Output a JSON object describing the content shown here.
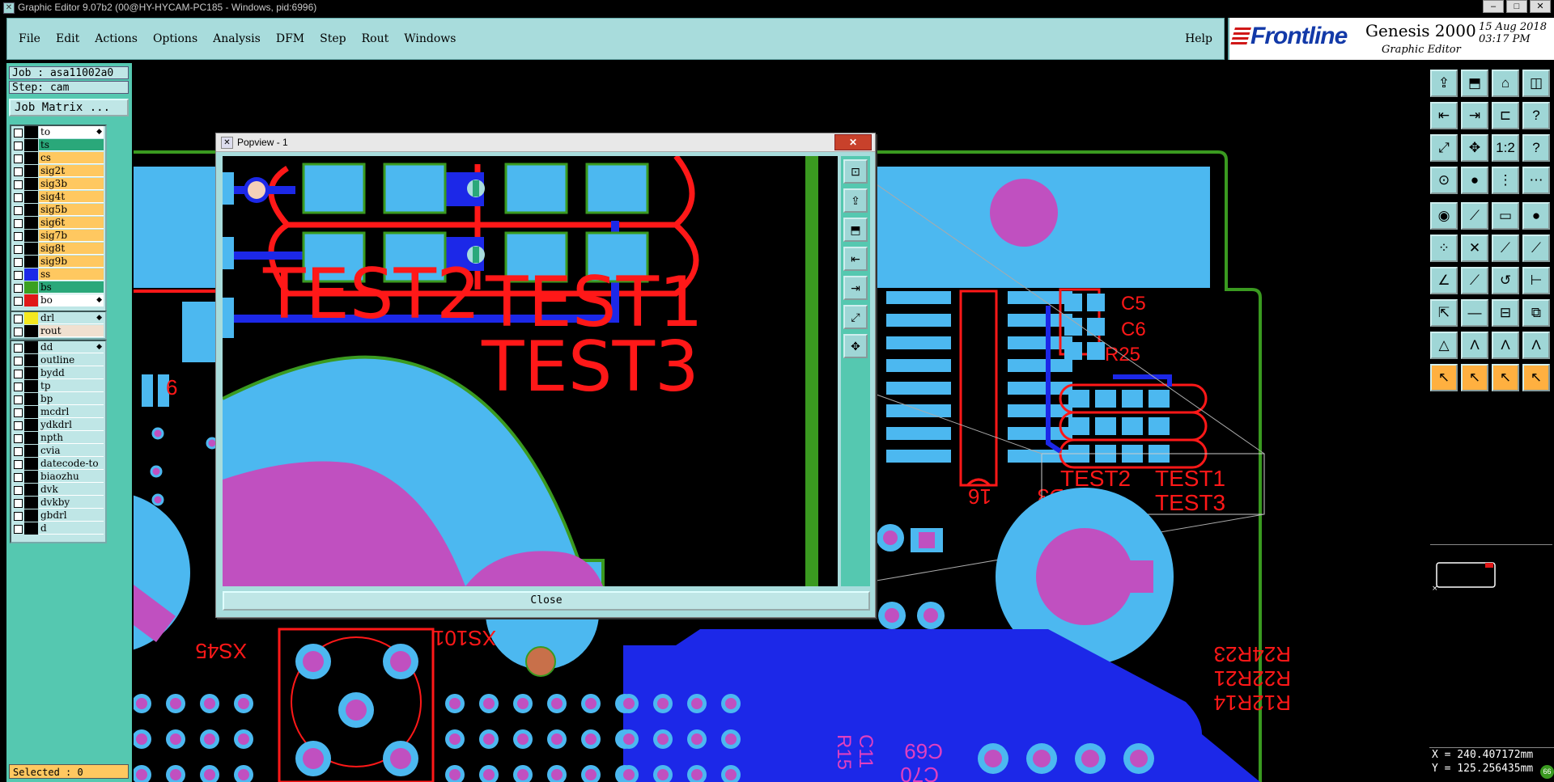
{
  "window": {
    "title": "Graphic Editor 9.07b2 (00@HY-HYCAM-PC185 - Windows, pid:6996)",
    "controls": [
      "–",
      "□",
      "✕"
    ]
  },
  "menu": {
    "items": [
      "File",
      "Edit",
      "Actions",
      "Options",
      "Analysis",
      "DFM",
      "Step",
      "Rout",
      "Windows"
    ],
    "help": "Help"
  },
  "logo": {
    "brand": "Frontline",
    "product": "Genesis 2000",
    "subtitle": "Graphic Editor",
    "date": "15 Aug 2018",
    "time": "03:17 PM"
  },
  "job": {
    "job_label": "Job : asa11002a0",
    "step_label": "Step: cam",
    "matrix_button": "Job Matrix ..."
  },
  "layers_group1": [
    {
      "name": "to",
      "color": "#ffffff",
      "swatch": "#000000",
      "arrow": true
    },
    {
      "name": "ts",
      "color": "#2aa87a",
      "swatch": "#000000"
    },
    {
      "name": "cs",
      "color": "#ffc860",
      "swatch": "#000000"
    },
    {
      "name": "sig2t",
      "color": "#ffc860",
      "swatch": "#000000"
    },
    {
      "name": "sig3b",
      "color": "#ffc860",
      "swatch": "#000000"
    },
    {
      "name": "sig4t",
      "color": "#ffc860",
      "swatch": "#000000"
    },
    {
      "name": "sig5b",
      "color": "#ffc860",
      "swatch": "#000000"
    },
    {
      "name": "sig6t",
      "color": "#ffc860",
      "swatch": "#000000"
    },
    {
      "name": "sig7b",
      "color": "#ffc860",
      "swatch": "#000000"
    },
    {
      "name": "sig8t",
      "color": "#ffc860",
      "swatch": "#000000"
    },
    {
      "name": "sig9b",
      "color": "#ffc860",
      "swatch": "#000000"
    },
    {
      "name": "ss",
      "color": "#ffc860",
      "swatch": "#1c28e8"
    },
    {
      "name": "bs",
      "color": "#2aa87a",
      "swatch": "#3aa020"
    },
    {
      "name": "bo",
      "color": "#ffffff",
      "swatch": "#e01818",
      "arrow": true
    }
  ],
  "layers_group2": [
    {
      "name": "drl",
      "color": "#bfe6e6",
      "swatch": "#f4e820",
      "arrow": true
    },
    {
      "name": "rout",
      "color": "#f0e0d0",
      "swatch": "#000000"
    }
  ],
  "layers_group3": [
    {
      "name": "dd",
      "color": "#bfe6e6",
      "swatch": "#000000",
      "arrow": true
    },
    {
      "name": "outline",
      "color": "#bfe6e6",
      "swatch": "#000000"
    },
    {
      "name": "bydd",
      "color": "#bfe6e6",
      "swatch": "#000000"
    },
    {
      "name": "tp",
      "color": "#bfe6e6",
      "swatch": "#000000"
    },
    {
      "name": "bp",
      "color": "#bfe6e6",
      "swatch": "#000000"
    },
    {
      "name": "mcdrl",
      "color": "#bfe6e6",
      "swatch": "#000000"
    },
    {
      "name": "ydkdrl",
      "color": "#bfe6e6",
      "swatch": "#000000"
    },
    {
      "name": "npth",
      "color": "#bfe6e6",
      "swatch": "#000000"
    },
    {
      "name": "cvia",
      "color": "#bfe6e6",
      "swatch": "#000000"
    },
    {
      "name": "datecode-to",
      "color": "#bfe6e6",
      "swatch": "#000000"
    },
    {
      "name": "biaozhu",
      "color": "#bfe6e6",
      "swatch": "#000000"
    },
    {
      "name": "dvk",
      "color": "#bfe6e6",
      "swatch": "#000000"
    },
    {
      "name": "dvkby",
      "color": "#bfe6e6",
      "swatch": "#000000"
    },
    {
      "name": "gbdrl",
      "color": "#bfe6e6",
      "swatch": "#000000"
    },
    {
      "name": "d",
      "color": "#bfe6e6",
      "swatch": "#000000"
    }
  ],
  "status": {
    "selected": "Selected : 0",
    "x": "X = 240.407172mm",
    "y": "Y = 125.256435mm"
  },
  "toolbar_icons": [
    [
      "open-icon",
      "save-icon",
      "home-icon",
      "layout-icon"
    ],
    [
      "zoom-in-icon",
      "zoom-out-icon",
      "zoom-fit-icon",
      "help-icon"
    ],
    [
      "fit-all-icon",
      "pan-icon",
      "scale-1-2-icon",
      "question-icon"
    ],
    [
      "snap-icon",
      "measure-icon",
      "net-icon",
      "grid-icon"
    ],
    [
      "pad-icon",
      "line-icon",
      "ruler-icon",
      "circle-icon"
    ],
    [
      "node-icon",
      "cross-icon",
      "point-icon",
      "via-icon"
    ],
    [
      "angle-icon",
      "diagonal-icon",
      "arc-icon",
      "text-icon"
    ],
    [
      "move-icon",
      "edit-line-icon",
      "resize-icon",
      "copy-icon"
    ],
    [
      "triangle-icon",
      "poly-icon",
      "outline-icon",
      "shape-icon"
    ],
    [
      "select-icon",
      "select-area-icon",
      "select-net-icon",
      "select-all-icon"
    ]
  ],
  "toolbar_glyphs": [
    [
      "⇪",
      "⬒",
      "⌂",
      "◫"
    ],
    [
      "⇤",
      "⇥",
      "⊏",
      "?"
    ],
    [
      "⤢",
      "✥",
      "1:2",
      "?"
    ],
    [
      "⊙",
      "●",
      "⋮",
      "⋯"
    ],
    [
      "◉",
      "⟋",
      "▭",
      "●"
    ],
    [
      "⁘",
      "✕",
      "⟋",
      "⟋"
    ],
    [
      "∠",
      "⟋",
      "↺",
      "⊢"
    ],
    [
      "⇱",
      "—",
      "⊟",
      "⧉"
    ],
    [
      "△",
      "Λ",
      "Λ",
      "Λ"
    ],
    [
      "↖",
      "↖",
      "↖",
      "↖"
    ]
  ],
  "popview": {
    "title": "Popview - 1",
    "close_x": "✕",
    "close_button": "Close",
    "texts": [
      "TEST2",
      "TEST1",
      "TEST3"
    ],
    "tool_glyphs": [
      "⊡",
      "⇪",
      "⬒",
      "⇤",
      "⇥",
      "⤢",
      "✥"
    ]
  },
  "board_labels": {
    "test2": "TEST2",
    "test1": "TEST1",
    "test3": "TEST3",
    "c5": "C5",
    "c6": "C6",
    "r25": "R25",
    "d3": "D3",
    "n16": "16",
    "xs45": "XS45",
    "xs101": "XS101",
    "r24r23": "R24R23",
    "r22r21": "R22R21",
    "r12r14": "R12R14",
    "c69": "C69",
    "c70": "C70",
    "r15": "R15",
    "c11": "C11",
    "n6": "6",
    "badge": "66"
  },
  "colors": {
    "copper_pad": "#4cb8f0",
    "silkscreen": "#ff1818",
    "solder": "#c050c0",
    "trace_blue": "#1c28e8",
    "outline_green": "#3a9a20",
    "panel_teal": "#55c8b0",
    "menu_bg": "#a8dcdc"
  }
}
